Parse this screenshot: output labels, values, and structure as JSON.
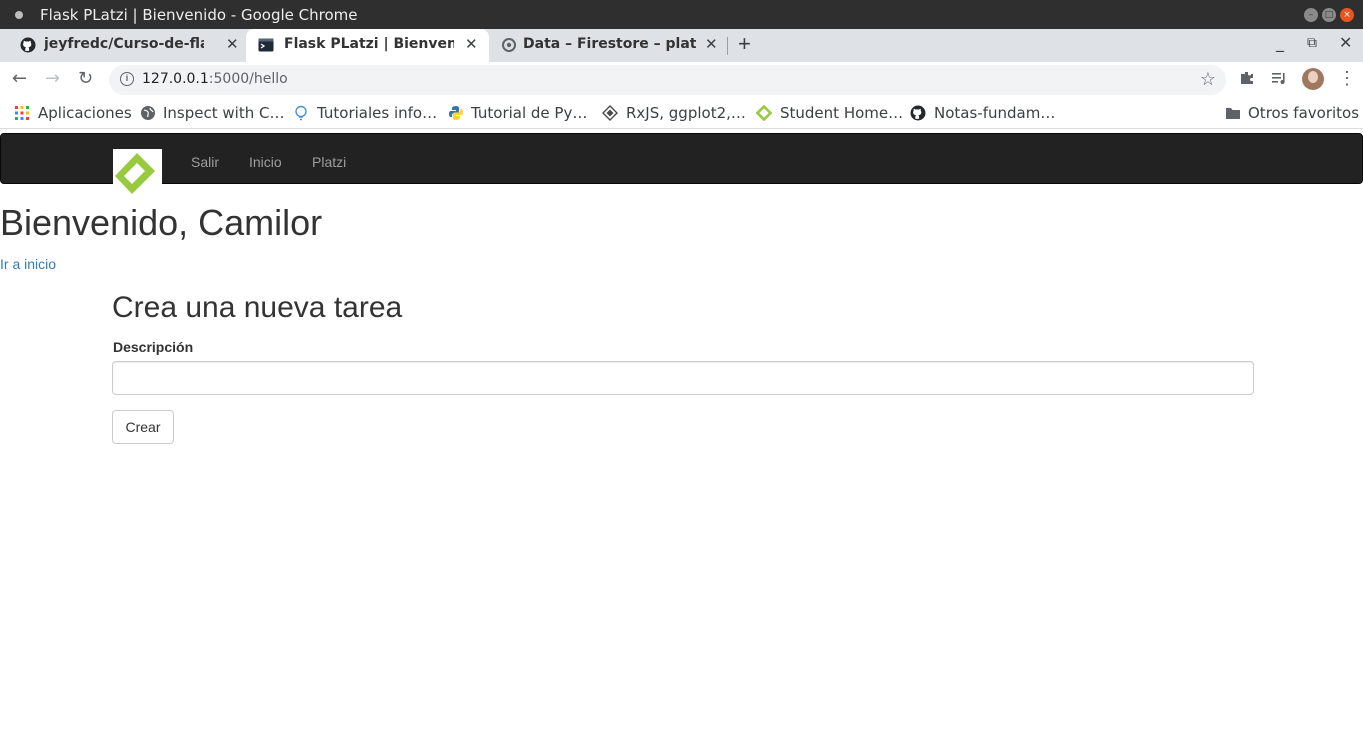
{
  "window": {
    "title": "Flask PLatzi | Bienvenido - Google Chrome"
  },
  "tabs": [
    {
      "label": "jeyfredc/Curso-de-flask",
      "icon": "github-icon",
      "active": false
    },
    {
      "label": "Flask PLatzi | Bienvenido",
      "icon": "terminal-icon",
      "active": true
    },
    {
      "label": "Data – Firestore – platzi-fl",
      "icon": "firebase-icon",
      "active": false
    }
  ],
  "address_bar": {
    "host": "127.0.0.1",
    "path": ":5000/hello"
  },
  "bookmarks": [
    {
      "label": "Aplicaciones",
      "icon": "apps-grid-icon"
    },
    {
      "label": "Inspect with C…",
      "icon": "globe-icon"
    },
    {
      "label": "Tutoriales info…",
      "icon": "bulb-icon"
    },
    {
      "label": "Tutorial de Py…",
      "icon": "python-icon"
    },
    {
      "label": "RxJS, ggplot2,…",
      "icon": "diamond-icon"
    },
    {
      "label": "Student Home…",
      "icon": "platzi-icon"
    },
    {
      "label": "Notas-fundam…",
      "icon": "github-icon"
    },
    {
      "label": "Otros favoritos",
      "icon": "folder-icon"
    }
  ],
  "navbar": {
    "links": [
      "Salir",
      "Inicio",
      "Platzi"
    ]
  },
  "page": {
    "heading": "Bienvenido, Camilor",
    "home_link": "Ir a inicio",
    "form_title": "Crea una nueva tarea",
    "field_label": "Descripción",
    "field_value": "",
    "submit_label": "Crear"
  },
  "colors": {
    "navbar_bg": "#222222",
    "navbar_link": "#9d9d9d",
    "link": "#337ab7",
    "brand_green": "#98ca3f"
  }
}
